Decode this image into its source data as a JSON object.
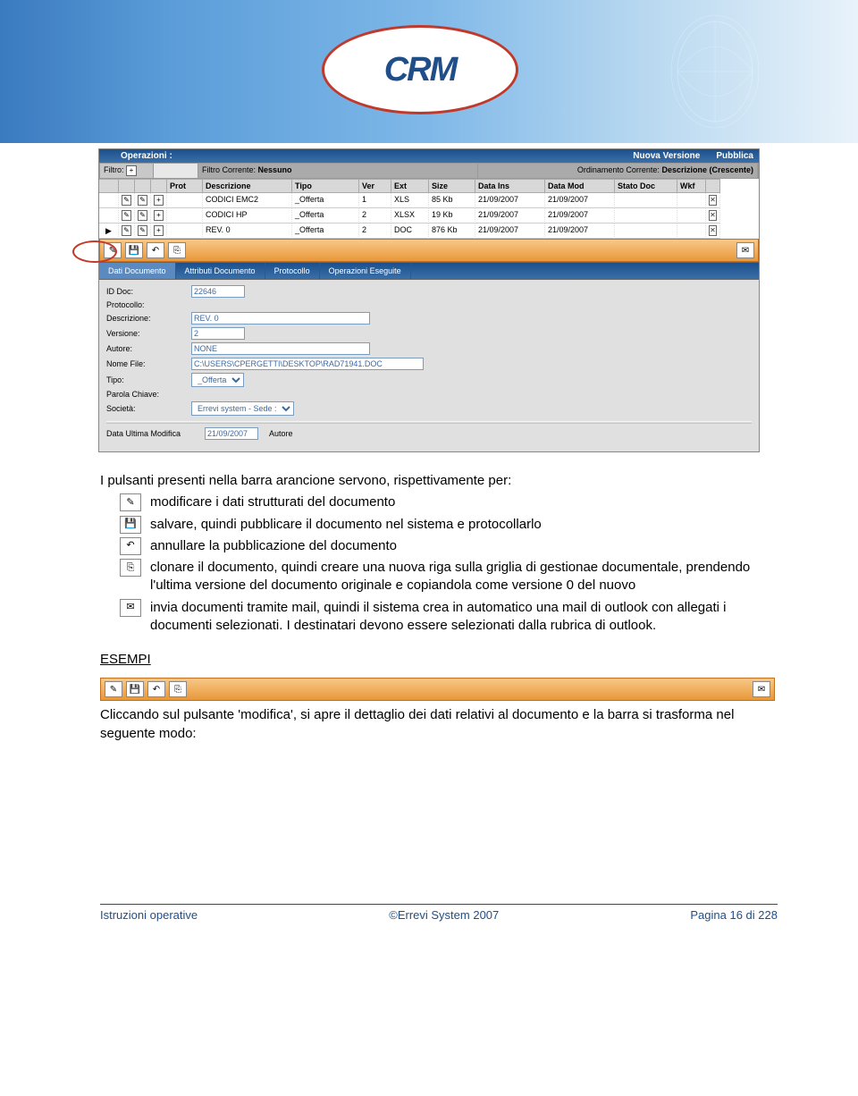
{
  "banner": {
    "logo_text": "CRM"
  },
  "ops": {
    "label": "Operazioni :",
    "nuova": "Nuova Versione",
    "pubblica": "Pubblica"
  },
  "filter": {
    "filtro": "Filtro:",
    "fc_lbl": "Filtro Corrente:",
    "fc_val": "Nessuno",
    "oc_lbl": "Ordinamento Corrente:",
    "oc_val": "Descrizione (Crescente)"
  },
  "grid": {
    "headers": [
      "",
      "",
      "",
      "",
      "Prot",
      "Descrizione",
      "Tipo",
      "Ver",
      "Ext",
      "Size",
      "Data Ins",
      "Data Mod",
      "Stato Doc",
      "Wkf",
      ""
    ],
    "rows": [
      {
        "desc": "CODICI EMC2",
        "tipo": "_Offerta",
        "ver": "1",
        "ext": "XLS",
        "size": "85 Kb",
        "ins": "21/09/2007",
        "mod": "21/09/2007"
      },
      {
        "desc": "CODICI HP",
        "tipo": "_Offerta",
        "ver": "2",
        "ext": "XLSX",
        "size": "19 Kb",
        "ins": "21/09/2007",
        "mod": "21/09/2007"
      },
      {
        "desc": "REV. 0",
        "tipo": "_Offerta",
        "ver": "2",
        "ext": "DOC",
        "size": "876 Kb",
        "ins": "21/09/2007",
        "mod": "21/09/2007"
      }
    ]
  },
  "orange_buttons": {
    "edit": "✎",
    "save": "💾",
    "undo": "↶",
    "clone": "⎘",
    "mail": "✉"
  },
  "tabs": [
    "Dati Documento",
    "Attributi Documento",
    "Protocollo",
    "Operazioni Eseguite"
  ],
  "form": {
    "iddoc_lbl": "ID Doc:",
    "iddoc": "22646",
    "prot_lbl": "Protocollo:",
    "desc_lbl": "Descrizione:",
    "desc": "REV. 0",
    "ver_lbl": "Versione:",
    "ver": "2",
    "autore_lbl": "Autore:",
    "autore": "NONE",
    "file_lbl": "Nome File:",
    "file": "C:\\USERS\\CPERGETTI\\DESKTOP\\RAD71941.DOC",
    "tipo_lbl": "Tipo:",
    "tipo": "_Offerta",
    "parola_lbl": "Parola Chiave:",
    "societa_lbl": "Società:",
    "societa": "Errevi system - Sede :",
    "dum_lbl": "Data Ultima Modifica",
    "dum": "21/09/2007",
    "autore2_lbl": "Autore"
  },
  "body": {
    "intro": "I pulsanti presenti nella barra arancione servono, rispettivamente per:",
    "items": [
      {
        "icon": "✎",
        "text": "modificare i dati strutturati del documento"
      },
      {
        "icon": "💾",
        "text": "salvare, quindi pubblicare il documento nel sistema e protocollarlo"
      },
      {
        "icon": "↶",
        "text": "annullare la pubblicazione del documento"
      },
      {
        "icon": "⎘",
        "text": "clonare il documento, quindi creare una nuova riga sulla griglia di gestionae documentale, prendendo l'ultima versione del documento originale e copiandola come versione 0 del nuovo"
      },
      {
        "icon": "✉",
        "text": "invia documenti tramite mail, quindi il sistema crea in automatico una mail di outlook con allegati i documenti selezionati. I destinatari devono essere selezionati dalla rubrica di outlook."
      }
    ],
    "esempi_hdr": "ESEMPI",
    "esempi_text": "Cliccando sul pulsante 'modifica', si apre il dettaglio dei dati relativi al documento e la barra si trasforma nel seguente modo:"
  },
  "footer": {
    "left": "Istruzioni operative",
    "center": "©Errevi System 2007",
    "right": "Pagina 16 di 228"
  }
}
